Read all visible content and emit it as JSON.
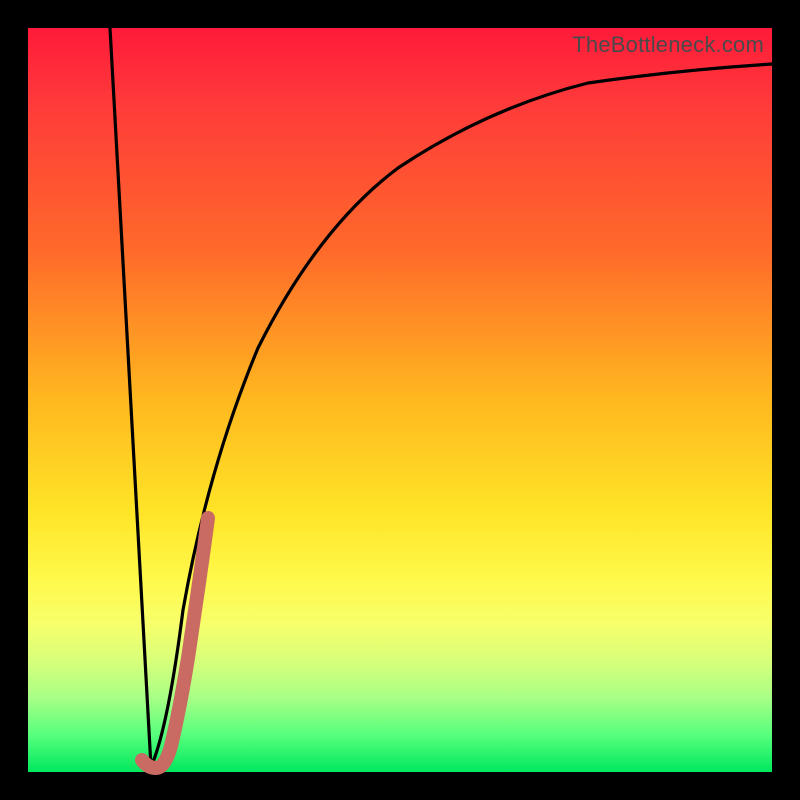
{
  "watermark": "TheBottleneck.com",
  "colors": {
    "background": "#000000",
    "gradient_top": "#ff1a3a",
    "gradient_mid": "#ffe427",
    "gradient_bottom": "#00e85e",
    "curve_black": "#000000",
    "curve_highlight": "#c96a63"
  },
  "chart_data": {
    "type": "line",
    "title": "",
    "xlabel": "",
    "ylabel": "",
    "xlim": [
      0,
      100
    ],
    "ylim": [
      0,
      100
    ],
    "grid": false,
    "series": [
      {
        "name": "black-curve",
        "x": [
          11,
          12,
          14,
          15,
          16.5,
          18,
          19,
          20,
          22,
          25,
          30,
          35,
          40,
          50,
          60,
          70,
          80,
          90,
          100
        ],
        "y": [
          100,
          60,
          20,
          6,
          0.5,
          6,
          14,
          22,
          36,
          52,
          68,
          77,
          82.5,
          88,
          91,
          92.8,
          94,
          94.8,
          95.2
        ]
      },
      {
        "name": "pink-highlight",
        "x": [
          15.3,
          15.8,
          16.5,
          17.2,
          18.0,
          18.8,
          19.6,
          20.4,
          21.2,
          21.8
        ],
        "y": [
          1.0,
          0.6,
          0.5,
          2.5,
          7.5,
          13.0,
          19.0,
          25.0,
          31.0,
          35.0
        ]
      }
    ],
    "notes": "Axes are unlabeled; values estimated from pixel positions on a 0–100 normalized scale. y=0 is the bottom (green), y=100 is the top (red). The black curve descends steeply from top-left, reaches ~0 near x≈16.5, then rises asymptotically toward ~95. The thick muted-pink segment overlays the black curve from roughly x≈15 to x≈22."
  }
}
